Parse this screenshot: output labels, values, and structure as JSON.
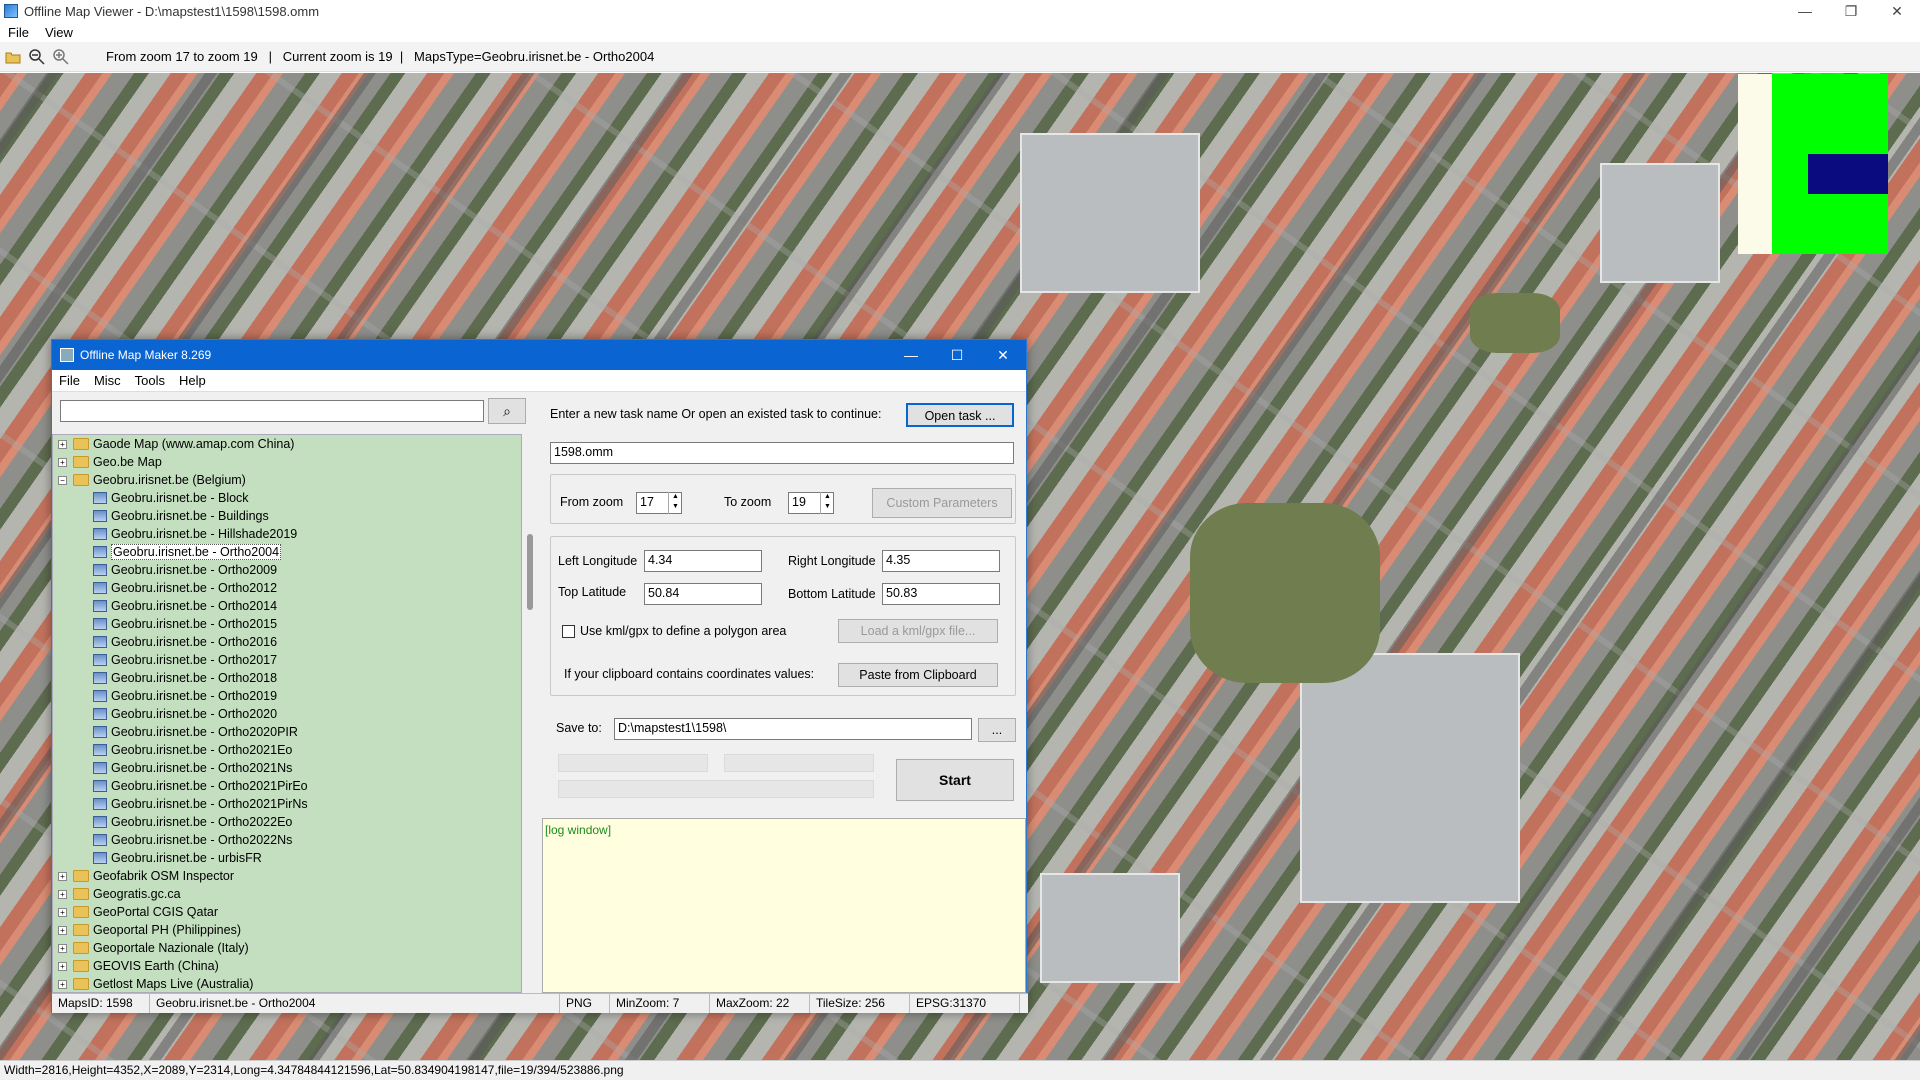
{
  "window": {
    "title": "Offline Map Viewer - D:\\mapstest1\\1598\\1598.omm",
    "controls": [
      "—",
      "❐",
      "✕"
    ]
  },
  "menu": [
    "File",
    "View"
  ],
  "toolbar": {
    "icons": [
      "open-folder-icon",
      "zoom-out-icon",
      "zoom-in-icon"
    ],
    "info": "From zoom 17 to zoom 19   |   Current zoom is 19  |   MapsType=Geobru.irisnet.be - Ortho2004"
  },
  "statusbar": "Width=2816,Height=4352,X=2089,Y=2314,Long=4.34784844121596,Lat=50.834904198147,file=19/394/523886.png",
  "dialog": {
    "title": "Offline Map Maker 8.269",
    "controls": [
      "—",
      "☐",
      "✕"
    ],
    "menu": [
      "File",
      "Misc",
      "Tools",
      "Help"
    ],
    "search_placeholder": "",
    "tree": [
      {
        "label": "Gaode Map (www.amap.com China)",
        "type": "folder",
        "expanded": false
      },
      {
        "label": "Geo.be Map",
        "type": "folder",
        "expanded": false
      },
      {
        "label": "Geobru.irisnet.be (Belgium)",
        "type": "folder",
        "expanded": true
      },
      {
        "label": "Geobru.irisnet.be - Block",
        "type": "map"
      },
      {
        "label": "Geobru.irisnet.be - Buildings",
        "type": "map"
      },
      {
        "label": "Geobru.irisnet.be - Hillshade2019",
        "type": "map"
      },
      {
        "label": "Geobru.irisnet.be - Ortho2004",
        "type": "map",
        "selected": true
      },
      {
        "label": "Geobru.irisnet.be - Ortho2009",
        "type": "map"
      },
      {
        "label": "Geobru.irisnet.be - Ortho2012",
        "type": "map"
      },
      {
        "label": "Geobru.irisnet.be - Ortho2014",
        "type": "map"
      },
      {
        "label": "Geobru.irisnet.be - Ortho2015",
        "type": "map"
      },
      {
        "label": "Geobru.irisnet.be - Ortho2016",
        "type": "map"
      },
      {
        "label": "Geobru.irisnet.be - Ortho2017",
        "type": "map"
      },
      {
        "label": "Geobru.irisnet.be - Ortho2018",
        "type": "map"
      },
      {
        "label": "Geobru.irisnet.be - Ortho2019",
        "type": "map"
      },
      {
        "label": "Geobru.irisnet.be - Ortho2020",
        "type": "map"
      },
      {
        "label": "Geobru.irisnet.be - Ortho2020PIR",
        "type": "map"
      },
      {
        "label": "Geobru.irisnet.be - Ortho2021Eo",
        "type": "map"
      },
      {
        "label": "Geobru.irisnet.be - Ortho2021Ns",
        "type": "map"
      },
      {
        "label": "Geobru.irisnet.be - Ortho2021PirEo",
        "type": "map"
      },
      {
        "label": "Geobru.irisnet.be - Ortho2021PirNs",
        "type": "map"
      },
      {
        "label": "Geobru.irisnet.be - Ortho2022Eo",
        "type": "map"
      },
      {
        "label": "Geobru.irisnet.be - Ortho2022Ns",
        "type": "map"
      },
      {
        "label": "Geobru.irisnet.be - urbisFR",
        "type": "map"
      },
      {
        "label": "Geofabrik OSM Inspector",
        "type": "folder",
        "expanded": false
      },
      {
        "label": "Geogratis.gc.ca",
        "type": "folder",
        "expanded": false
      },
      {
        "label": "GeoPortal CGIS Qatar",
        "type": "folder",
        "expanded": false
      },
      {
        "label": "Geoportal PH (Philippines)",
        "type": "folder",
        "expanded": false
      },
      {
        "label": "Geoportale Nazionale (Italy)",
        "type": "folder",
        "expanded": false
      },
      {
        "label": "GEOVIS Earth (China)",
        "type": "folder",
        "expanded": false
      },
      {
        "label": "Getlost Maps Live (Australia)",
        "type": "folder",
        "expanded": false
      }
    ],
    "task_prompt": "Enter a new task name Or open an existed task to continue:",
    "open_task_label": "Open task ...",
    "task_name": "1598.omm",
    "from_zoom_label": "From zoom",
    "from_zoom": "17",
    "to_zoom_label": "To zoom",
    "to_zoom": "19",
    "custom_params_label": "Custom Parameters",
    "left_lon_label": "Left Longitude",
    "left_lon": "4.34",
    "right_lon_label": "Right Longitude",
    "right_lon": "4.35",
    "top_lat_label": "Top Latitude",
    "top_lat": "50.84",
    "bottom_lat_label": "Bottom Latitude",
    "bottom_lat": "50.83",
    "kml_label": "Use kml/gpx to define a polygon area",
    "load_kml_label": "Load a kml/gpx file...",
    "clipboard_prompt": "If your clipboard contains coordinates values:",
    "paste_label": "Paste from Clipboard",
    "save_to_label": "Save to:",
    "save_to": "D:\\mapstest1\\1598\\",
    "browse_label": "...",
    "start_label": "Start",
    "log_text": "[log window]",
    "status": {
      "maps_id": "MapsID: 1598",
      "map_name": "Geobru.irisnet.be - Ortho2004",
      "format": "PNG",
      "min_zoom": "MinZoom: 7",
      "max_zoom": "MaxZoom: 22",
      "tile_size": "TileSize: 256",
      "epsg": "EPSG:31370"
    }
  }
}
